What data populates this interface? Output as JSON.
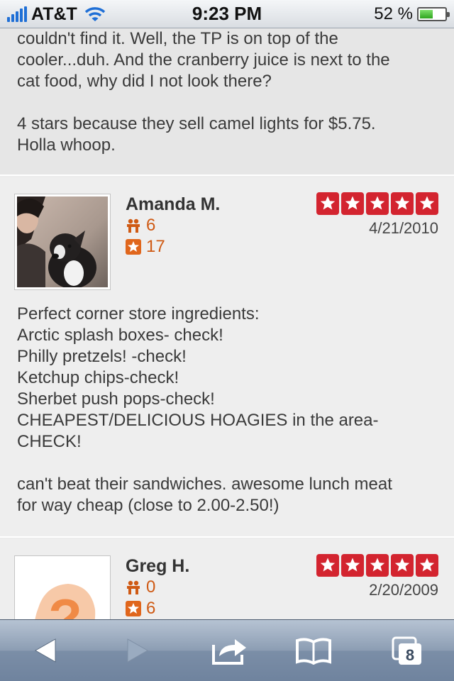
{
  "status_bar": {
    "carrier": "AT&T",
    "time": "9:23 PM",
    "battery_percent": "52 %",
    "battery_level": 0.52
  },
  "previous_review": {
    "text": "couldn't find it. Well, the TP is on top of the\ncooler...duh. And the cranberry juice is next to the\ncat food, why did I not look there?\n\n4 stars because they sell camel lights for $5.75.\nHolla whoop."
  },
  "reviews": [
    {
      "name": "Amanda M.",
      "friends": "6",
      "reviews_count": "17",
      "rating": 5,
      "date": "4/21/2010",
      "text": "Perfect corner store ingredients:\nArctic splash boxes- check!\nPhilly pretzels! -check!\nKetchup chips-check!\nSherbet push pops-check!\nCHEAPEST/DELICIOUS HOAGIES in the area-\nCHECK!\n\ncan't beat their sandwiches. awesome lunch meat\nfor way cheap (close to 2.00-2.50!)"
    },
    {
      "name": "Greg H.",
      "friends": "0",
      "reviews_count": "6",
      "rating": 5,
      "date": "2/20/2009"
    }
  ],
  "toolbar": {
    "tabs_count": "8",
    "icons": [
      "back-icon",
      "forward-icon",
      "share-icon",
      "bookmarks-icon",
      "tabs-icon"
    ]
  },
  "colors": {
    "star_red": "#d3242f",
    "stat_orange": "#cf5a14",
    "toolbar_blue": "#8c9db3"
  }
}
